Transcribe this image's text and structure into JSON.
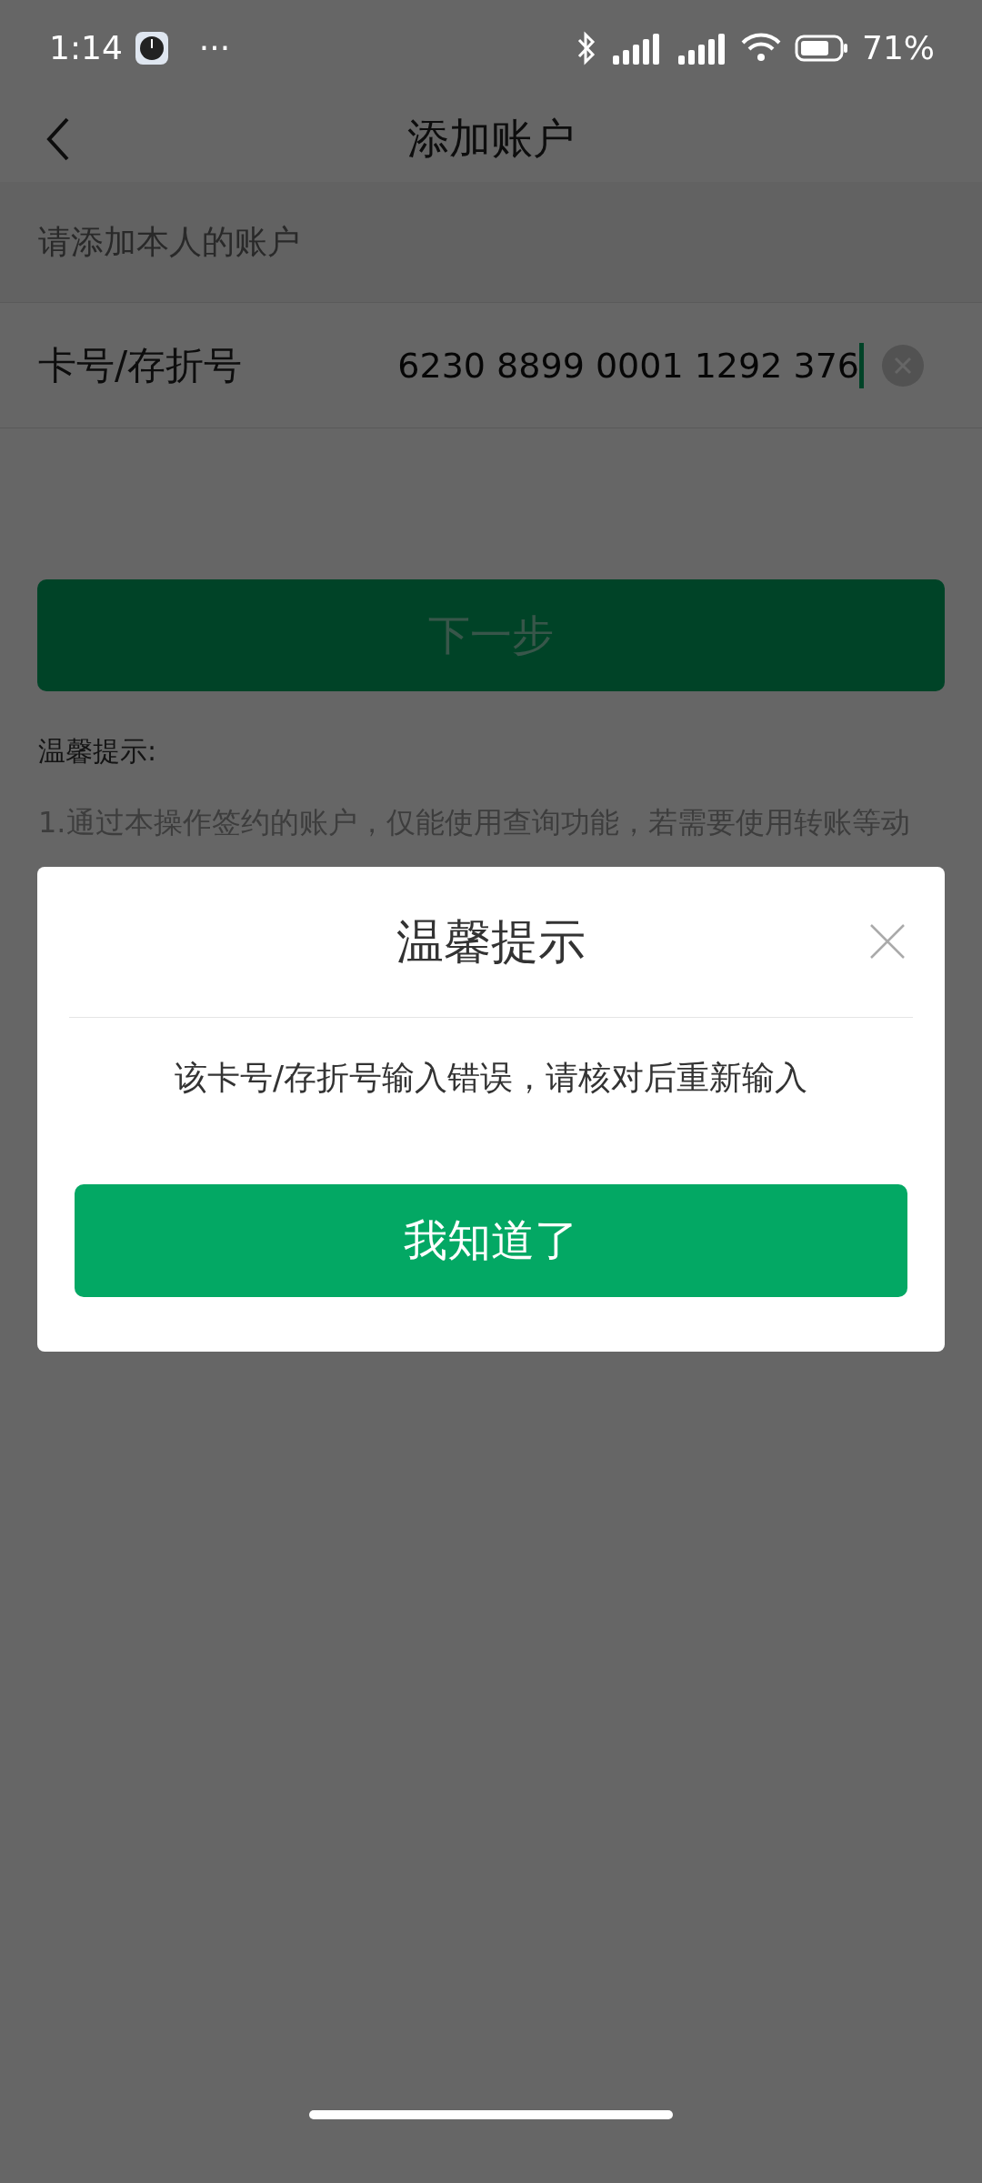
{
  "status_bar": {
    "time": "1:14",
    "more": "···",
    "battery": "71%"
  },
  "header": {
    "title": "添加账户"
  },
  "subtitle": "请添加本人的账户",
  "card_field": {
    "label": "卡号/存折号",
    "value": "6230 8899 0001 1292 376"
  },
  "next_button": {
    "label": "下一步",
    "disabled": true
  },
  "tips": {
    "title": "温馨提示:",
    "lines": [
      "1.通过本操作签约的账户，仅能使用查询功能，若需要使用转账等动"
    ]
  },
  "dialog": {
    "title": "温馨提示",
    "message": "该卡号/存折号输入错误，请核对后重新输入",
    "button": "我知道了"
  }
}
